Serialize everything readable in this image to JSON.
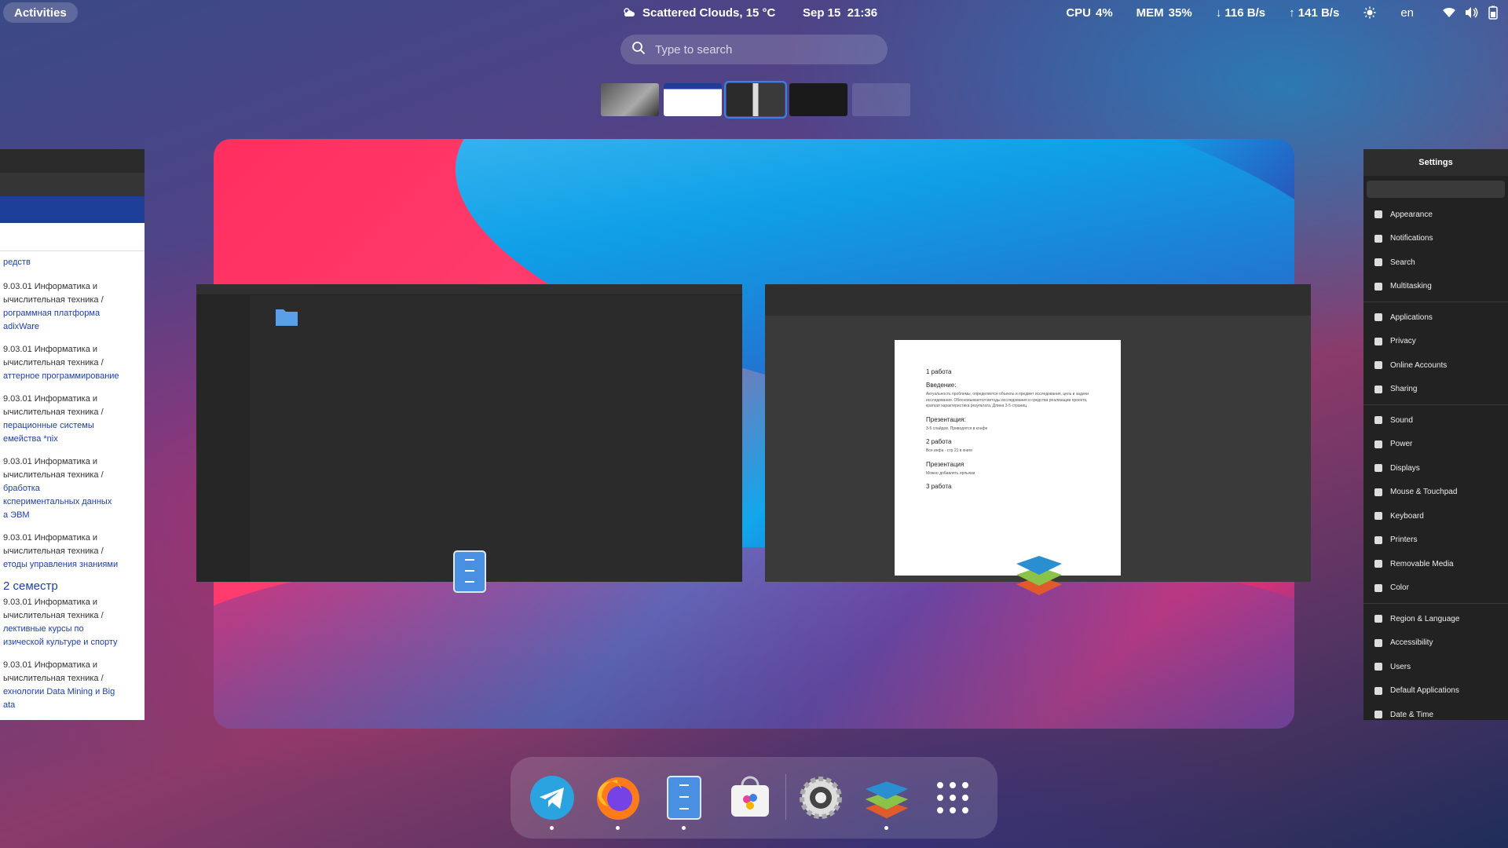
{
  "topbar": {
    "activities_label": "Activities",
    "weather": "Scattered Clouds, 15 °C",
    "clock": "Sep 15  21:36",
    "cpu_label": "CPU",
    "cpu_value": "4%",
    "mem_label": "MEM",
    "mem_value": "35%",
    "download": "↓ 116 B/s",
    "upload": "↑ 141 B/s",
    "language": "en"
  },
  "search": {
    "placeholder": "Type to search"
  },
  "browser_window": {
    "items": [
      "редств",
      "9.03.01 Информатика и",
      "ычислительная техника /",
      "рограммная платформа",
      "adixWare",
      "9.03.01 Информатика и",
      "ычислительная техника /",
      "аттерное программирование",
      "9.03.01 Информатика и",
      "ычислительная техника /",
      "перационные системы",
      "емейства *nix",
      "9.03.01 Информатика и",
      "ычислительная техника /",
      "бработка",
      "кспериментальных данных",
      "а ЭВМ",
      "9.03.01 Информатика и",
      "ычислительная техника /",
      "етоды управления знаниями"
    ],
    "semester": "2 семестр",
    "items2": [
      "9.03.01 Информатика и",
      "ычислительная техника /",
      "лективные курсы по",
      "изической культуре и спорту",
      "9.03.01 Информатика и",
      "ычислительная техника /",
      "ехнологии Data Mining и Big",
      "ata"
    ]
  },
  "document_window": {
    "h1": "1 работа",
    "intro": "Введение:",
    "intro_text": "Актуальность проблемы, определяется объекты и предмет исследования, цель и задачи исследования. Обосновываются методы исследования и средства реализации проекта, краткая характеристика результата. Длина 3-5 страниц.",
    "pres1": "Презентация:",
    "pres1_text": "3-5 слайдов. Приводятся в конфе",
    "h2": "2 работа",
    "h2_text": "Все инфа - стр 21 в книге",
    "pres2": "Презентация",
    "pres2_text": "Можно добавлять ярлычки",
    "h3": "3 работа"
  },
  "settings_window": {
    "title": "Settings",
    "groups": [
      [
        "Appearance",
        "Notifications",
        "Search",
        "Multitasking"
      ],
      [
        "Applications",
        "Privacy",
        "Online Accounts",
        "Sharing"
      ],
      [
        "Sound",
        "Power",
        "Displays",
        "Mouse & Touchpad",
        "Keyboard",
        "Printers",
        "Removable Media",
        "Color"
      ],
      [
        "Region & Language",
        "Accessibility",
        "Users",
        "Default Applications",
        "Date & Time"
      ]
    ]
  },
  "dock": {
    "apps": [
      "telegram-icon",
      "firefox-icon",
      "files-icon",
      "software-center-icon",
      "settings-icon",
      "onlyoffice-icon",
      "app-grid-icon"
    ],
    "running": [
      true,
      true,
      true,
      false,
      false,
      true,
      false
    ]
  },
  "colors": {
    "accent": "#3584e4",
    "topbar_text": "#ffffff"
  }
}
